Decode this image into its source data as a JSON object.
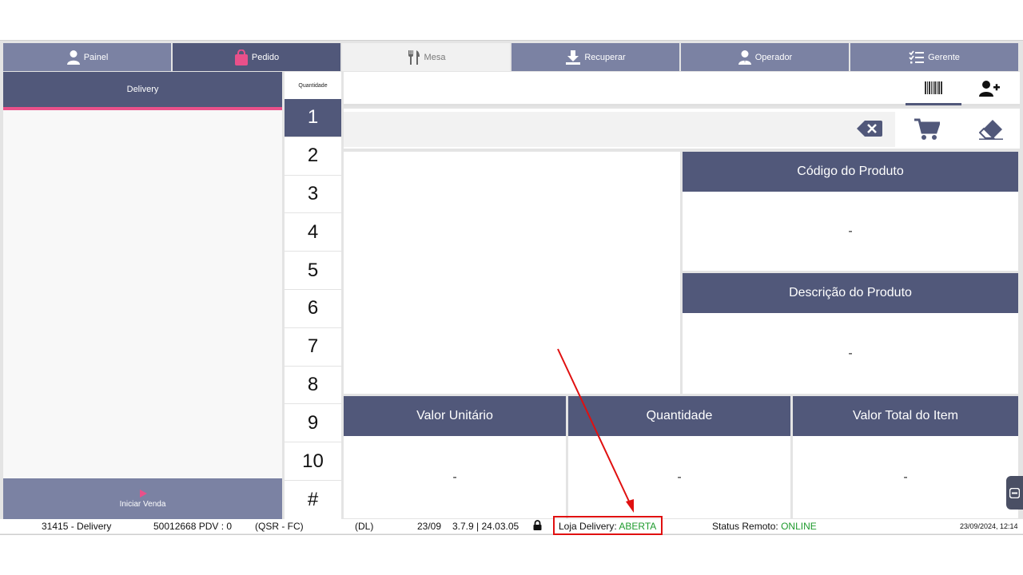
{
  "tabs": [
    {
      "label": "Painel",
      "icon": "person-icon"
    },
    {
      "label": "Pedido",
      "icon": "shopping-bag-icon"
    },
    {
      "label": "Mesa",
      "icon": "fork-knife-icon"
    },
    {
      "label": "Recuperar",
      "icon": "download-icon"
    },
    {
      "label": "Operador",
      "icon": "operator-icon"
    },
    {
      "label": "Gerente",
      "icon": "checklist-icon"
    }
  ],
  "left": {
    "delivery_label": "Delivery",
    "start_sale_label": "Iniciar Venda"
  },
  "quantity": {
    "label": "Quantidade",
    "buttons": [
      "1",
      "2",
      "3",
      "4",
      "5",
      "6",
      "7",
      "8",
      "9",
      "10",
      "#"
    ],
    "selected": "1"
  },
  "search": {
    "value": ""
  },
  "product": {
    "code_header": "Código do Produto",
    "code_value": "-",
    "description_header": "Descrição do Produto",
    "description_value": "-"
  },
  "totals": {
    "unit_header": "Valor Unitário",
    "unit_value": "-",
    "qty_header": "Quantidade",
    "qty_value": "-",
    "total_header": "Valor Total do Item",
    "total_value": "-"
  },
  "status": {
    "store": "31415 - Delivery",
    "pdv": "50012668 PDV : 0",
    "mode": "(QSR - FC)",
    "dl": "(DL)",
    "date": "23/09",
    "version": "3.7.9 | 24.03.05",
    "delivery_label": "Loja Delivery:",
    "delivery_value": "ABERTA",
    "remote_label": "Status Remoto:",
    "remote_value": "ONLINE",
    "datetime": "23/09/2024, 12:14"
  },
  "colors": {
    "primary": "#51587a",
    "secondary": "#7b82a3",
    "accent": "#e9508a",
    "ok": "#1e9a2d",
    "annotation": "#e01010"
  }
}
